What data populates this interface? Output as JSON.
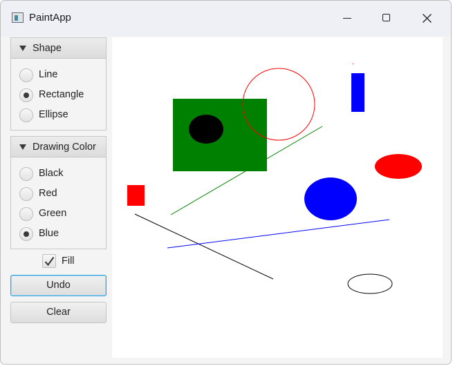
{
  "window": {
    "title": "PaintApp"
  },
  "shape_panel": {
    "title": "Shape",
    "options": [
      {
        "label": "Line",
        "checked": false
      },
      {
        "label": "Rectangle",
        "checked": true
      },
      {
        "label": "Ellipse",
        "checked": false
      }
    ]
  },
  "color_panel": {
    "title": "Drawing Color",
    "options": [
      {
        "label": "Black",
        "checked": false
      },
      {
        "label": "Red",
        "checked": false
      },
      {
        "label": "Green",
        "checked": false
      },
      {
        "label": "Blue",
        "checked": true
      }
    ]
  },
  "fill": {
    "label": "Fill",
    "checked": true
  },
  "buttons": {
    "undo": "Undo",
    "clear": "Clear"
  },
  "colors": {
    "black": "#000000",
    "red": "#ff0000",
    "green": "#008000",
    "blue": "#0000ff",
    "focus_ring": "#2ea2dc"
  }
}
